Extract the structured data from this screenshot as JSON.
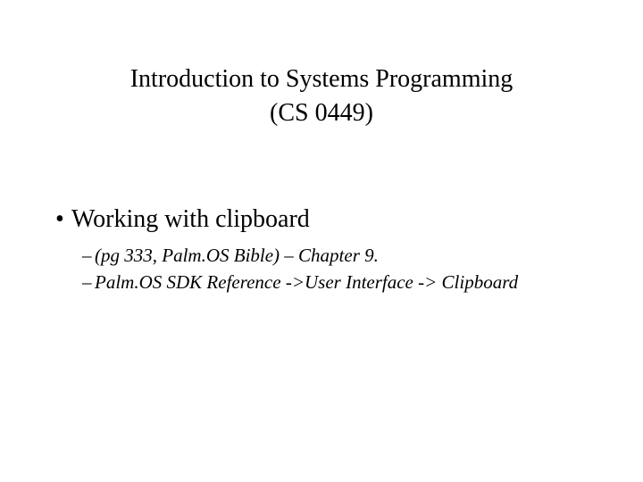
{
  "title": {
    "line1": "Introduction to Systems Programming",
    "line2": "(CS 0449)"
  },
  "content": {
    "bullet_marker": "•",
    "bullet_text": "Working with clipboard",
    "sub_marker": "–",
    "sub1": "(pg 333, Palm.OS Bible) – Chapter 9.",
    "sub2": "Palm.OS SDK Reference ->User Interface -> Clipboard"
  }
}
